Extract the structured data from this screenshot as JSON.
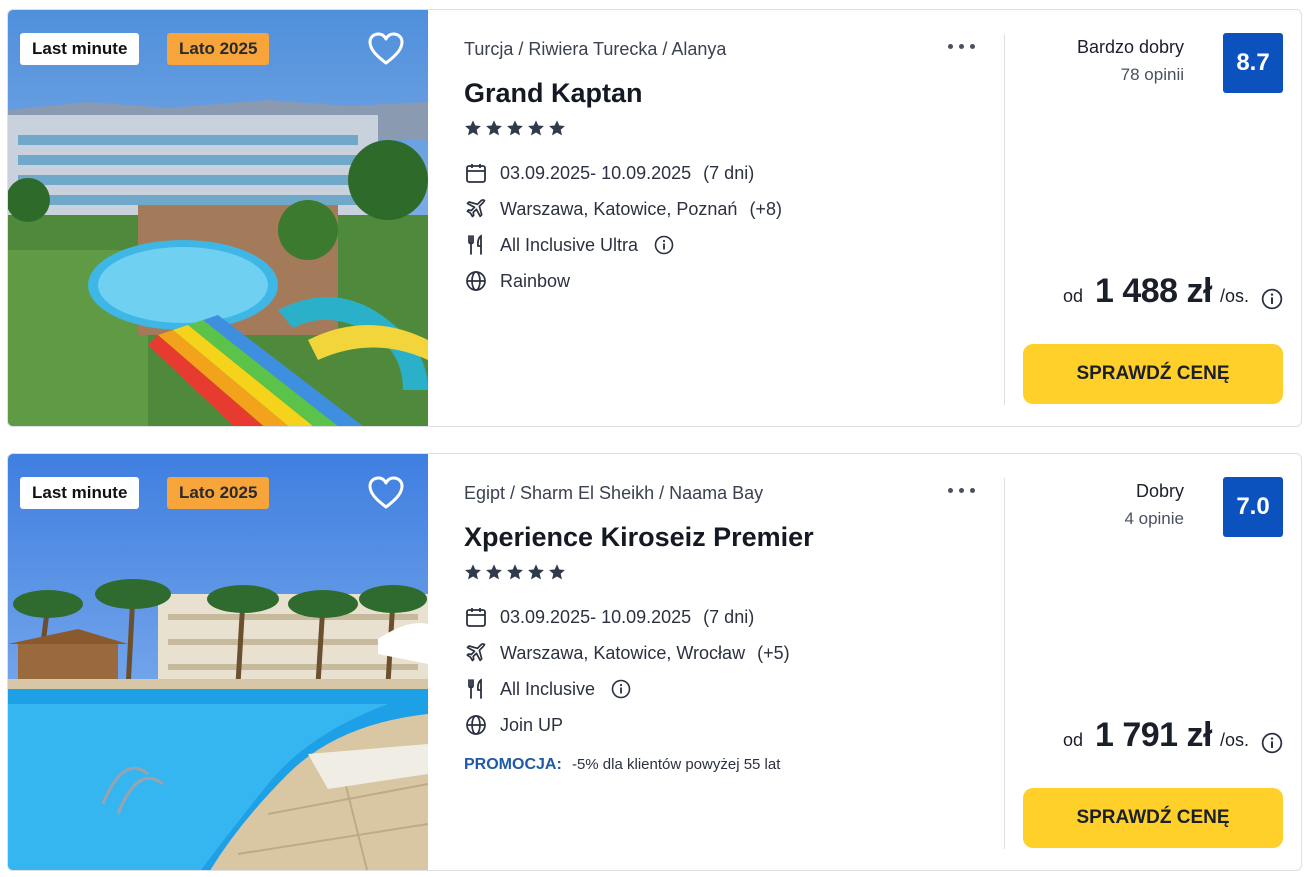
{
  "colors": {
    "score_bg": "#0b52bf",
    "cta_bg": "#ffd02a",
    "season_tag_bg": "#f7a53a",
    "promo_label": "#1f5aa8"
  },
  "offers": [
    {
      "tags": {
        "last_minute": "Last minute",
        "season": "Lato 2025"
      },
      "breadcrumb": "Turcja / Riwiera Turecka / Alanya",
      "name": "Grand Kaptan",
      "stars": 5,
      "dates": "03.09.2025- 10.09.2025",
      "duration": "(7 dni)",
      "departures": "Warszawa, Katowice, Poznań",
      "departures_more": "(+8)",
      "board": "All Inclusive Ultra",
      "operator": "Rainbow",
      "rating_label": "Bardzo dobry",
      "reviews": "78 opinii",
      "score": "8.7",
      "price_prefix": "od",
      "price": "1 488 zł",
      "price_unit": "/os.",
      "cta": "SPRAWDŹ CENĘ",
      "image_icon": "hotel-pool-waterslide-photo"
    },
    {
      "tags": {
        "last_minute": "Last minute",
        "season": "Lato 2025"
      },
      "breadcrumb": "Egipt / Sharm El Sheikh / Naama Bay",
      "name": "Xperience Kiroseiz Premier",
      "stars": 5,
      "dates": "03.09.2025- 10.09.2025",
      "duration": "(7 dni)",
      "departures": "Warszawa, Katowice, Wrocław",
      "departures_more": "(+5)",
      "board": "All Inclusive",
      "operator": "Join UP",
      "promo_label": "PROMOCJA:",
      "promo_text": "-5% dla klientów powyżej 55 lat",
      "rating_label": "Dobry",
      "reviews": "4 opinie",
      "score": "7.0",
      "price_prefix": "od",
      "price": "1 791 zł",
      "price_unit": "/os.",
      "cta": "SPRAWDŹ CENĘ",
      "image_icon": "resort-pool-palms-photo"
    }
  ]
}
